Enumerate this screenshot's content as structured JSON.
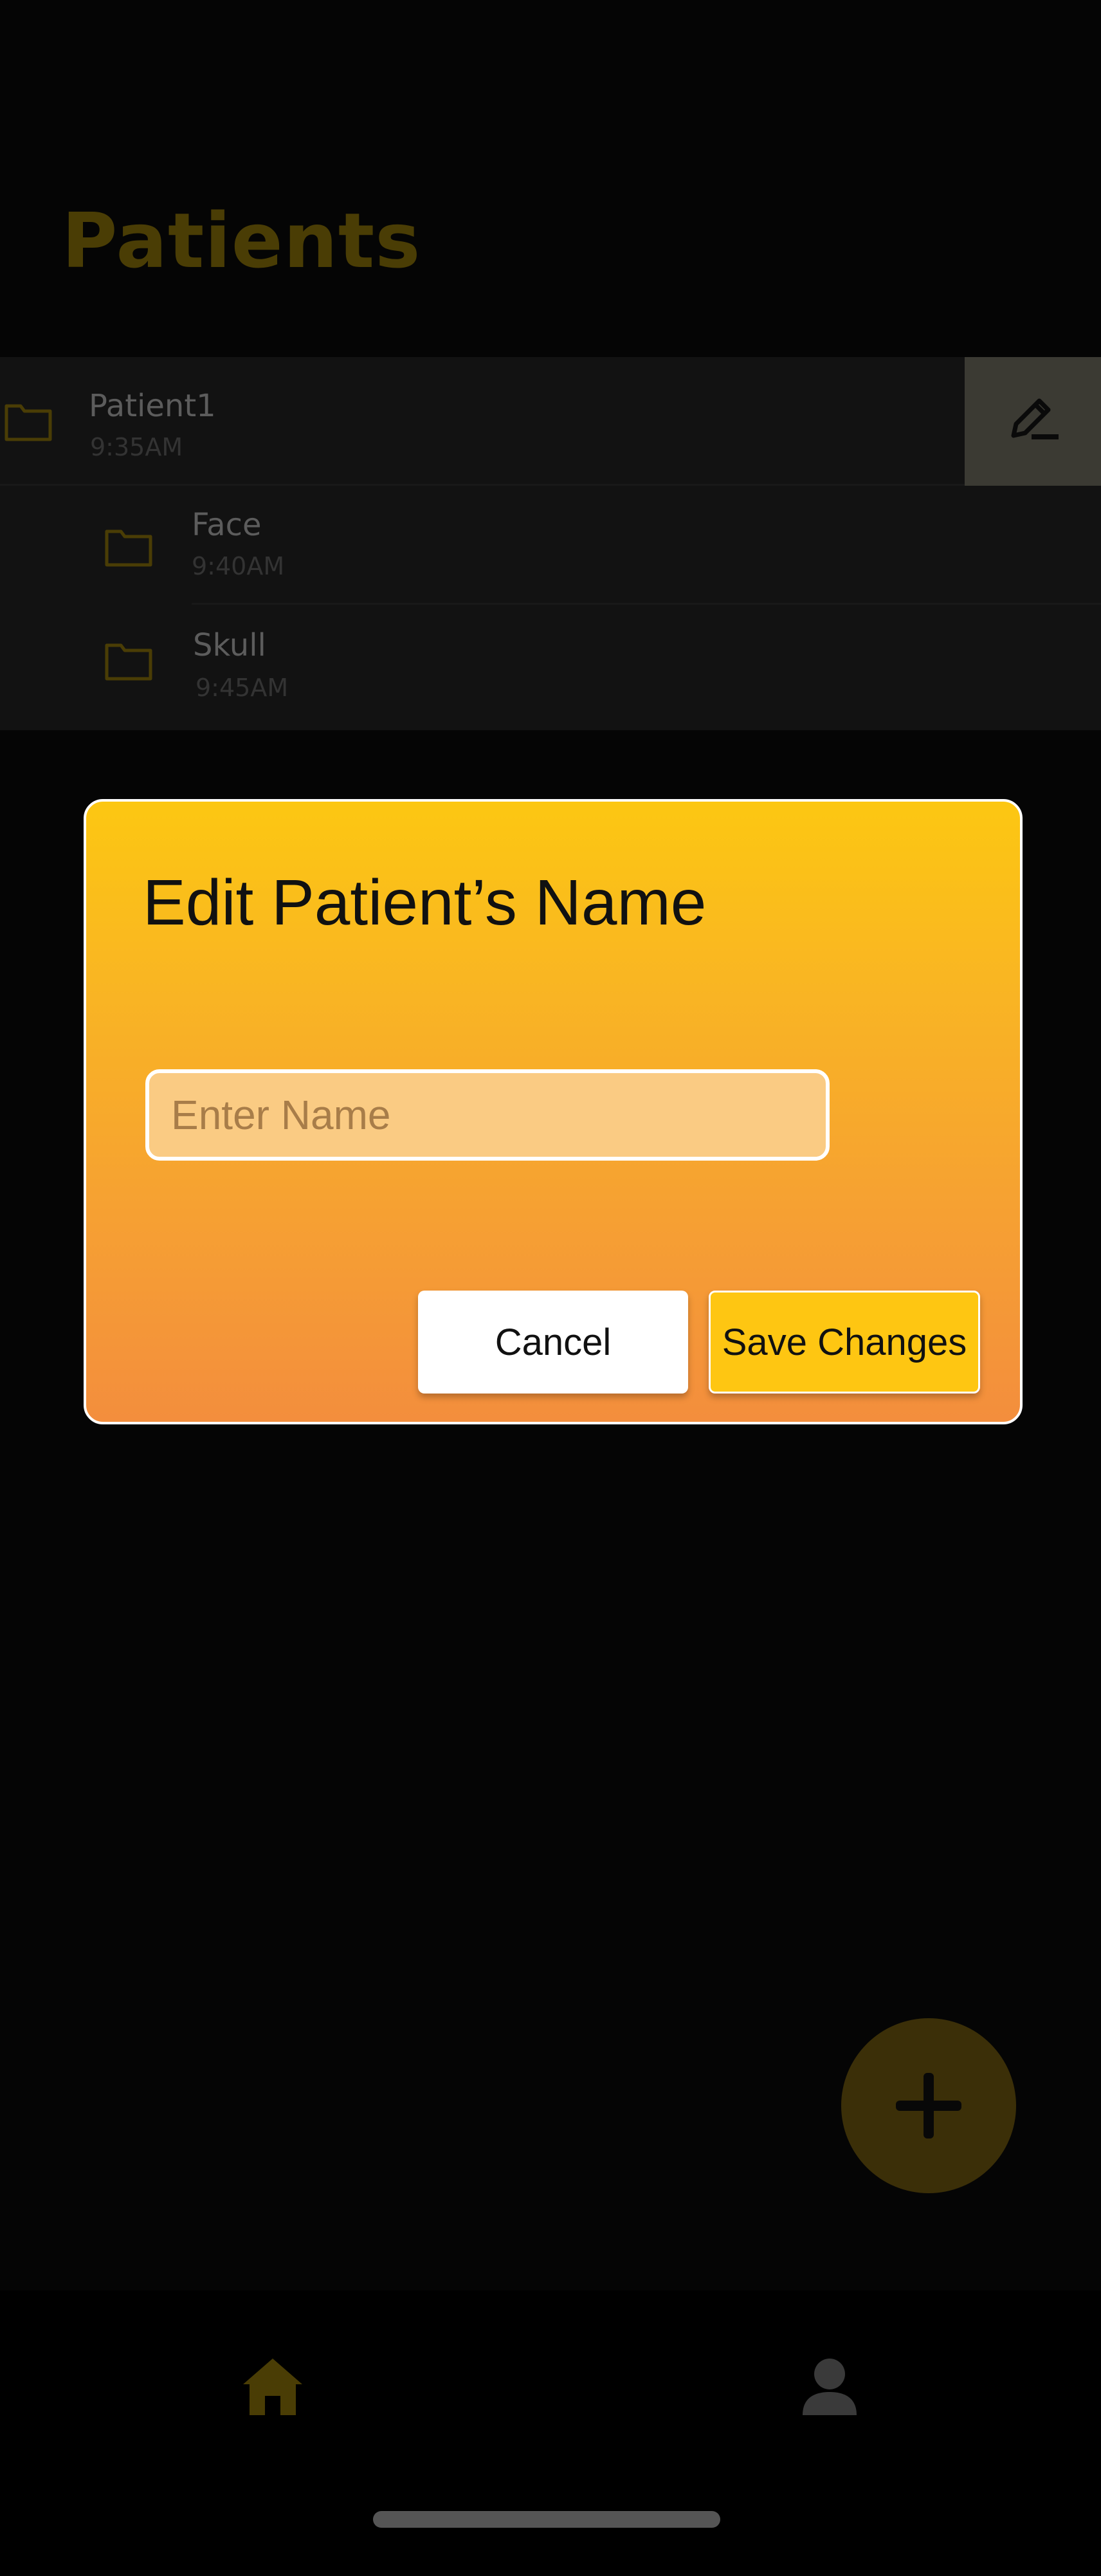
{
  "page": {
    "title": "Patients"
  },
  "patients": [
    {
      "name": "Patient1",
      "time": "9:35AM"
    },
    {
      "name": "Face",
      "time": "9:40AM"
    },
    {
      "name": "Skull",
      "time": "9:45AM"
    }
  ],
  "icons": {
    "folder": "folder-icon",
    "edit": "pencil-edit-icon",
    "add": "plus-icon",
    "home": "home-icon",
    "profile": "person-icon"
  },
  "dialog": {
    "title": "Edit Patient’s Name",
    "input_placeholder": "Enter Name",
    "input_value": "",
    "cancel_label": "Cancel",
    "save_label": "Save Changes"
  },
  "colors": {
    "accent": "#FEC612",
    "modal_gradient_top": "#FCC712",
    "modal_gradient_bottom": "#F38E3D",
    "background": "#050505"
  }
}
